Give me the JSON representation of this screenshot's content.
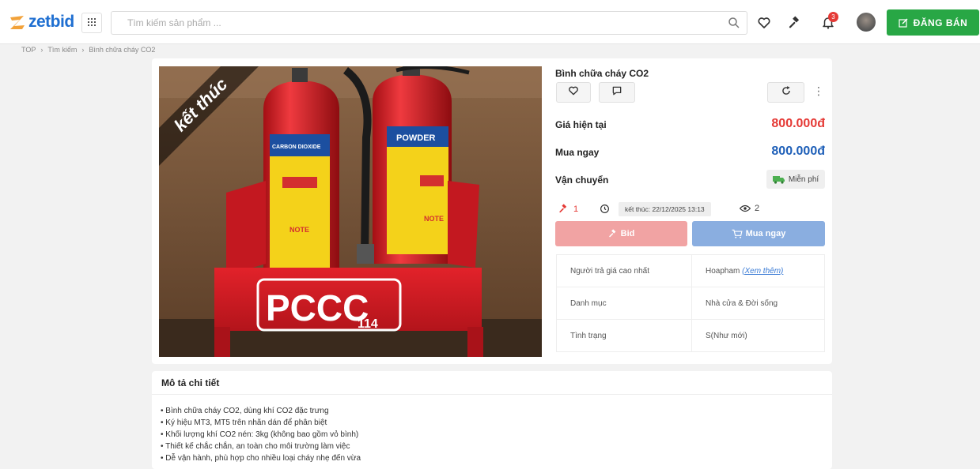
{
  "header": {
    "logo_text": "zetbid",
    "search_placeholder": "Tìm kiếm sản phẩm ...",
    "notification_count": "3",
    "sell_label": "ĐĂNG BÁN",
    "icons": [
      "grid-icon",
      "search-icon",
      "heart-icon",
      "gavel-icon",
      "bell-icon",
      "avatar",
      "edit-icon"
    ]
  },
  "breadcrumb": {
    "items": [
      "TOP",
      "Tìm kiếm",
      "Bình chữa cháy CO2"
    ]
  },
  "product": {
    "ribbon_text": "kết thúc",
    "title": "Bình chữa cháy CO2",
    "current_price_label": "Giá hiện tại",
    "current_price": "800.000đ",
    "buy_now_label": "Mua ngay",
    "buy_now_price": "800.000đ",
    "shipping_label": "Vận chuyển",
    "shipping_value": "Miễn phí",
    "bid_count": "1",
    "end_time": "kết thúc: 22/12/2025 13:13",
    "view_count": "2",
    "bid_button": "Bid",
    "buy_button": "Mua ngay",
    "info": [
      {
        "label": "Người trả giá cao nhất",
        "value": "Hoapham",
        "link": "(Xem thêm)"
      },
      {
        "label": "Danh mục",
        "value": "Nhà cửa & Đời sống"
      },
      {
        "label": "Tình trạng",
        "value": "S(Như mới)"
      }
    ]
  },
  "description": {
    "title": "Mô tả chi tiết",
    "lines": [
      "• Bình chữa cháy CO2, dùng khí CO2 đặc trưng",
      "• Ký hiệu MT3, MT5 trên nhãn dán để phân biệt",
      "• Khối lượng khí CO2 nén: 3kg (không bao gồm vỏ bình)",
      "• Thiết kế chắc chắn, an toàn cho môi trường làm việc",
      "• Dễ vận hành, phù hợp cho nhiều loại cháy nhẹ đến vừa"
    ]
  },
  "photo": {
    "stand_text": "PCCC",
    "stand_number": "114",
    "label_left": "CARBON DIOXIDE",
    "label_right": "POWDER",
    "note_text": "NOTE"
  },
  "colors": {
    "brand_blue": "#1f6fd1",
    "price_red": "#e53935",
    "price_blue": "#1e5fb8",
    "sell_green": "#28a745",
    "bid_pink": "#f1a3a3",
    "buy_blue": "#8aaee0"
  }
}
